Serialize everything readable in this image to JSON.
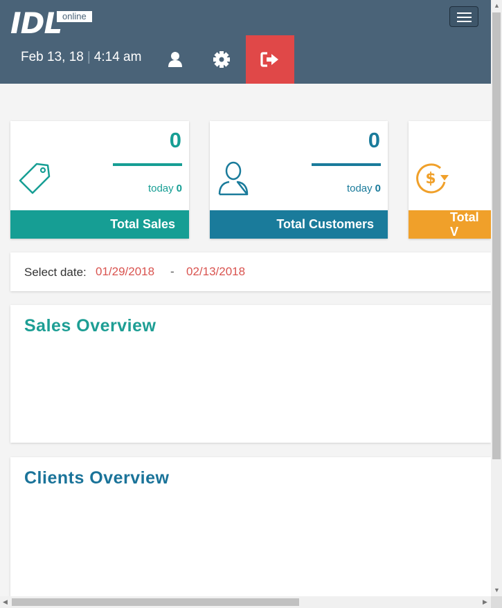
{
  "header": {
    "logo_text": "IDL",
    "logo_badge": "online",
    "date": "Feb 13, 18",
    "time": "4:14 am",
    "icons": [
      "user-icon",
      "gear-icon",
      "sign-out-icon"
    ]
  },
  "cards": [
    {
      "count": "0",
      "today_label": "today",
      "today_value": "0",
      "title": "Total Sales",
      "color": "#169e94",
      "icon": "tag-icon"
    },
    {
      "count": "0",
      "today_label": "today",
      "today_value": "0",
      "title": "Total Customers",
      "color": "#1a7b9b",
      "icon": "user-outline-icon"
    },
    {
      "title": "Total V",
      "color": "#f0a02a",
      "icon": "dollar-refresh-icon"
    }
  ],
  "date_filter": {
    "label": "Select date:",
    "from": "01/29/2018",
    "separator": "-",
    "to": "02/13/2018"
  },
  "panels": [
    {
      "title": "Sales Overview",
      "color": "#1d9e94"
    },
    {
      "title": "Clients Overview",
      "color": "#1a7399"
    }
  ]
}
